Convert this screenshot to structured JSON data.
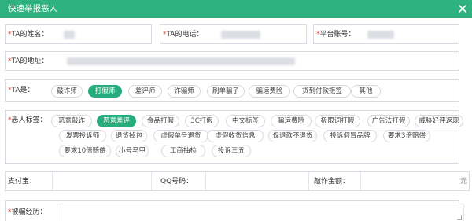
{
  "dialog": {
    "title": "快速举报恶人",
    "close_icon": "close-icon"
  },
  "colors": {
    "accent": "#2eb27f",
    "required": "#e84c3d",
    "border": "#d6dbe4"
  },
  "form": {
    "required_mark": "*",
    "name_label": "TA的姓名：",
    "phone_label": "TA的电话：",
    "platform_label": "平台账号：",
    "address_label": "TA的地址：",
    "type_label": "TA是：",
    "tags_label": "恶人标签：",
    "alipay_label": "支付宝：",
    "qq_label": "QQ号码：",
    "amount_label": "敲诈金额：",
    "amount_unit": "元",
    "experience_label": "被骗经历："
  },
  "type_options": [
    {
      "label": "敲诈师",
      "selected": false
    },
    {
      "label": "打假师",
      "selected": true
    },
    {
      "label": "差评师",
      "selected": false
    },
    {
      "label": "诈骗师",
      "selected": false
    },
    {
      "label": "刷单骗子",
      "selected": false
    },
    {
      "label": "骗运费险",
      "selected": false
    },
    {
      "label": "货到付款拒签",
      "selected": false
    },
    {
      "label": "其他",
      "selected": false
    }
  ],
  "tag_options": [
    {
      "label": "恶意敲诈",
      "selected": false
    },
    {
      "label": "恶意差评",
      "selected": true
    },
    {
      "label": "食品打假",
      "selected": false
    },
    {
      "label": "3C打假",
      "selected": false
    },
    {
      "label": "中文标签",
      "selected": false
    },
    {
      "label": "骗运费险",
      "selected": false
    },
    {
      "label": "极限词打假",
      "selected": false
    },
    {
      "label": "广告法打假",
      "selected": false
    },
    {
      "label": "威胁好评返现",
      "selected": false
    },
    {
      "label": "发票投诉师",
      "selected": false
    },
    {
      "label": "退货掉包",
      "selected": false
    },
    {
      "label": "虚假单号退货",
      "selected": false
    },
    {
      "label": "虚假收货信息",
      "selected": false
    },
    {
      "label": "仅退款不退货",
      "selected": false
    },
    {
      "label": "投诉假冒品牌",
      "selected": false
    },
    {
      "label": "要求3倍赔偿",
      "selected": false
    },
    {
      "label": "要求10倍赔偿",
      "selected": false
    },
    {
      "label": "小号马甲",
      "selected": false
    },
    {
      "label": "工商抽检",
      "selected": false
    },
    {
      "label": "投诉三五",
      "selected": false
    }
  ]
}
